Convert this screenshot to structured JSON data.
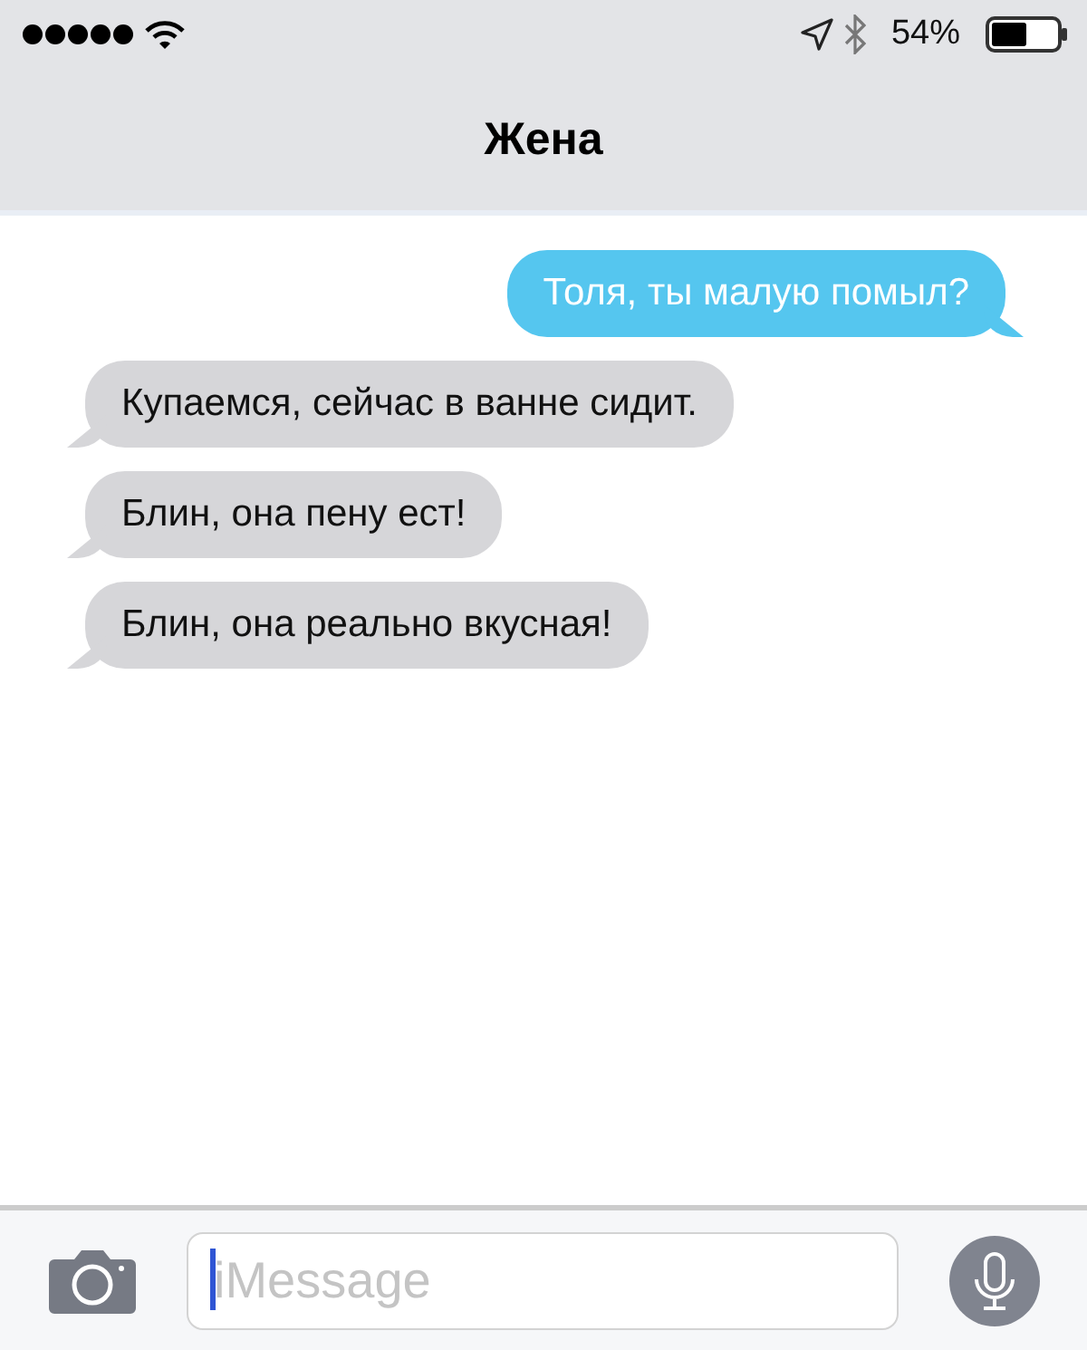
{
  "status_bar": {
    "battery_percent": "54%"
  },
  "header": {
    "title": "Жена"
  },
  "messages": [
    {
      "kind": "outgoing",
      "text": "Толя, ты малую помыл?"
    },
    {
      "kind": "incoming",
      "text": "Купаемся, сейчас в ванне сидит."
    },
    {
      "kind": "incoming",
      "text": "Блин, она пену ест!"
    },
    {
      "kind": "incoming",
      "text": "Блин, она реально вкусная!"
    }
  ],
  "compose_bar": {
    "placeholder": "iMessage"
  }
}
